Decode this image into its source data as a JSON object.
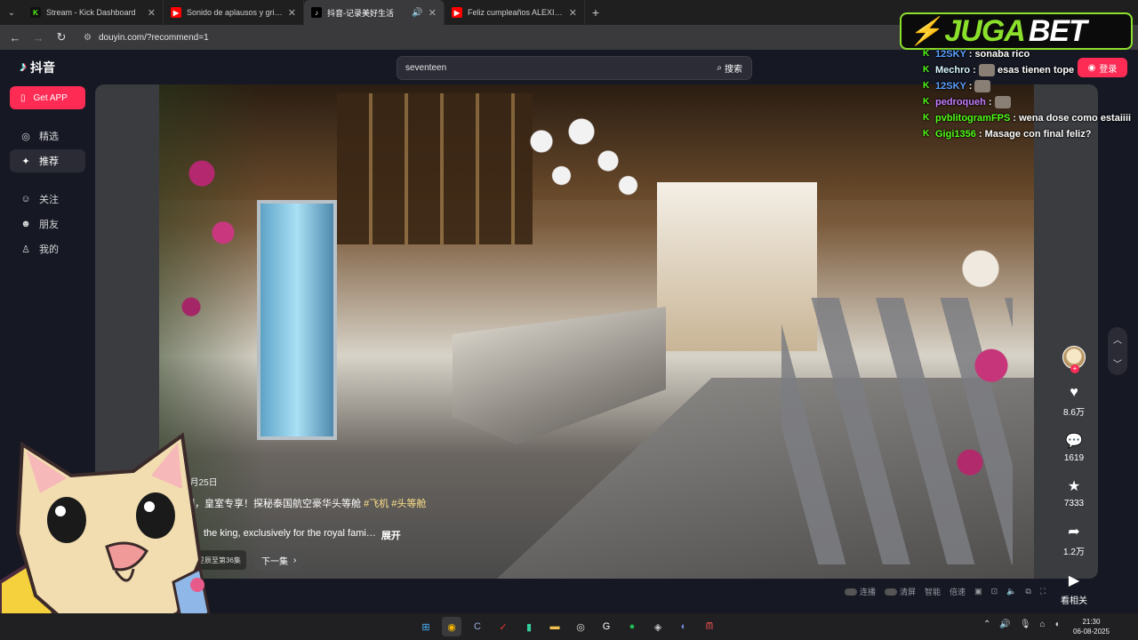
{
  "browser": {
    "tabs": [
      {
        "title": "Stream - Kick Dashboard",
        "favicon": "kick-icon",
        "color": "#53fc18",
        "glyph": "K"
      },
      {
        "title": "Sonido de aplausos y gritos",
        "favicon": "youtube-icon",
        "color": "#ff0000",
        "glyph": "▶"
      },
      {
        "title": "抖音-记录美好生活",
        "favicon": "douyin-icon",
        "color": "#000000",
        "glyph": "♪",
        "active": true
      },
      {
        "title": "Feliz cumpleaños ALEXIS con M",
        "favicon": "youtube-icon",
        "color": "#ff0000",
        "glyph": "▶"
      }
    ],
    "url": "douyin.com/?recommend=1"
  },
  "douyin": {
    "logo": "抖音",
    "get_app": "Get APP",
    "nav": [
      {
        "label": "精选",
        "icon": "compass-icon"
      },
      {
        "label": "推荐",
        "icon": "sparkle-icon",
        "active": true
      },
      {
        "label": "关注",
        "icon": "follow-icon"
      },
      {
        "label": "朋友",
        "icon": "friends-icon"
      },
      {
        "label": "我的",
        "icon": "profile-icon"
      }
    ],
    "search": {
      "value": "seventeen",
      "button": "搜索"
    },
    "login": "登录"
  },
  "video": {
    "date": "6月25日",
    "title_text": "制，皇室专享！探秘泰国航空豪华头等舱",
    "tags": [
      "#飞机",
      "#头等舱"
    ],
    "desc": "the king, exclusively for the royal fami…",
    "desc_more": "展开",
    "chip": "星辰至第36集",
    "next": "下一集",
    "actions": [
      {
        "icon": "heart-icon",
        "glyph": "♥",
        "count": "8.6万"
      },
      {
        "icon": "comment-icon",
        "glyph": "●",
        "count": "1619"
      },
      {
        "icon": "star-icon",
        "glyph": "★",
        "count": "7333"
      },
      {
        "icon": "share-icon",
        "glyph": "➦",
        "count": "1.2万"
      },
      {
        "icon": "play-related-icon",
        "glyph": "▶",
        "count": "看相关"
      }
    ],
    "controls": [
      "连播",
      "清屏",
      "智能",
      "倍速"
    ]
  },
  "overlay": {
    "sponsor": {
      "part1": "JUGA",
      "part2": "BET"
    },
    "chat": [
      {
        "user": "12SKY",
        "text": "sonaba rico",
        "color": "#5aa0ff"
      },
      {
        "user": "Mechro",
        "text": "esas tienen tope",
        "color": "#ffffff",
        "emote": true
      },
      {
        "user": "12SKY",
        "text": "",
        "color": "#5aa0ff",
        "emote": true
      },
      {
        "user": "pedroqueh",
        "text": "",
        "color": "#c47cff",
        "emote": true
      },
      {
        "user": "pvblitogramFPS",
        "text": "wena dose como estaiiii",
        "color": "#53fc18"
      },
      {
        "user": "Gigi1356",
        "text": "Masage con final feliz?",
        "color": "#53fc18"
      }
    ]
  },
  "taskbar": {
    "time": "21:30",
    "date": "06-08-2025"
  }
}
